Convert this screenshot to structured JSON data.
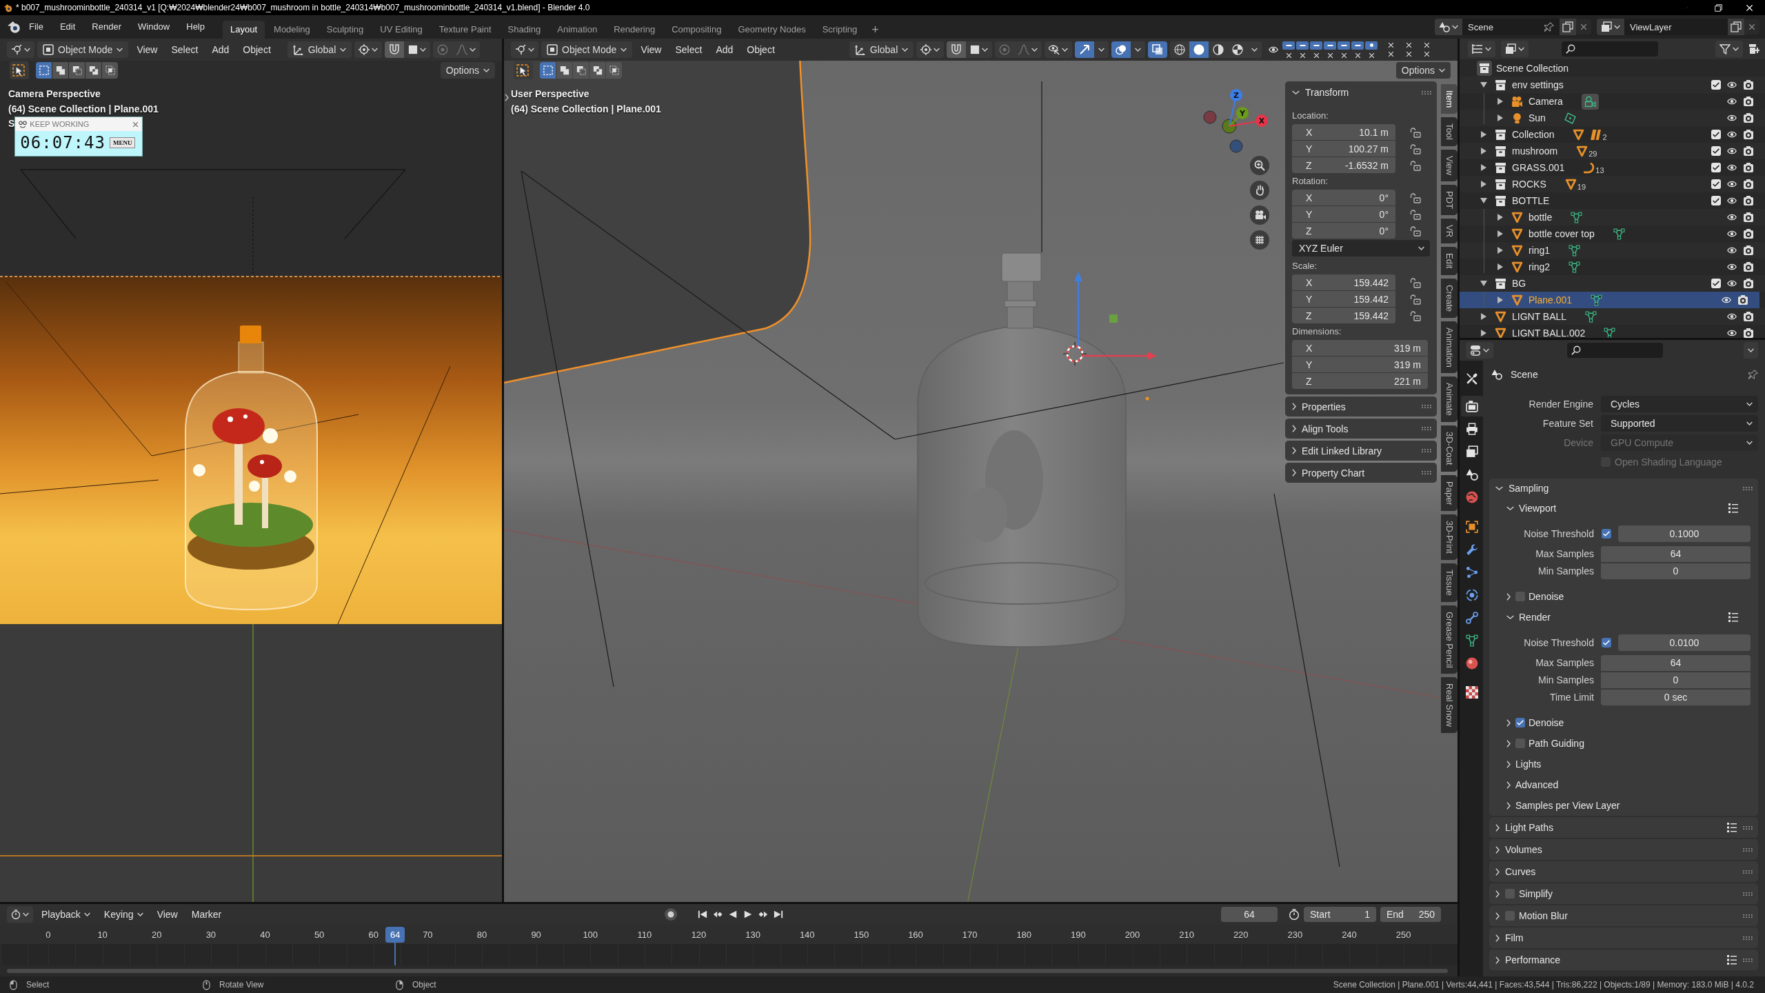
{
  "title_bar": {
    "title": "* b007_mushroominbottle_240314_v1 [Q:₩2024₩blender24₩b007_mushroom in bottle_240314₩b007_mushroominbottle_240314_v1.blend] - Blender 4.0"
  },
  "top_bar": {
    "menus": [
      "File",
      "Edit",
      "Render",
      "Window",
      "Help"
    ],
    "workspaces": [
      {
        "label": "Layout",
        "selected": true
      },
      {
        "label": "Modeling",
        "selected": false
      },
      {
        "label": "Sculpting",
        "selected": false
      },
      {
        "label": "UV Editing",
        "selected": false
      },
      {
        "label": "Texture Paint",
        "selected": false
      },
      {
        "label": "Shading",
        "selected": false
      },
      {
        "label": "Animation",
        "selected": false
      },
      {
        "label": "Rendering",
        "selected": false
      },
      {
        "label": "Compositing",
        "selected": false
      },
      {
        "label": "Geometry Nodes",
        "selected": false
      },
      {
        "label": "Scripting",
        "selected": false
      }
    ],
    "add_workspace": "+",
    "scene": "Scene",
    "view_layer": "ViewLayer"
  },
  "camera_view": {
    "header": {
      "mode": "Object Mode",
      "menus": [
        "View",
        "Select",
        "Add",
        "Object"
      ],
      "orientation": "Global",
      "snap": true,
      "proportional": false
    },
    "select_modes": [
      {
        "kind": "set",
        "selected": true
      },
      {
        "kind": "extend",
        "selected": false
      },
      {
        "kind": "subtract",
        "selected": false
      },
      {
        "kind": "difference",
        "selected": false
      },
      {
        "kind": "intersect",
        "selected": false
      }
    ],
    "options": "Options",
    "overlay": [
      "Camera Perspective",
      "(64) Scene Collection | Plane.001"
    ],
    "overlay_partial": "S",
    "timer": {
      "title": "KEEP WORKING",
      "time": "06:07:43",
      "menu": "MENU"
    }
  },
  "main_view": {
    "header": {
      "mode": "Object Mode",
      "menus": [
        "View",
        "Select",
        "Add",
        "Object"
      ],
      "orientation": "Global",
      "snap": true,
      "proportional": false,
      "gizmos": true,
      "overlays": true,
      "xray": true,
      "shading": [
        {
          "kind": "wireframe",
          "selected": false
        },
        {
          "kind": "solid",
          "selected": true
        },
        {
          "kind": "material",
          "selected": false
        },
        {
          "kind": "rendered",
          "selected": false
        }
      ],
      "toggles": [
        {
          "kind": "dash",
          "on": true
        },
        {
          "kind": "dash",
          "on": true
        },
        {
          "kind": "dash",
          "on": true
        },
        {
          "kind": "dash",
          "on": true
        },
        {
          "kind": "dash",
          "on": true
        },
        {
          "kind": "dash",
          "on": true
        },
        {
          "kind": "dot",
          "on": true
        }
      ]
    },
    "select_modes": [
      {
        "kind": "set",
        "selected": true
      },
      {
        "kind": "extend",
        "selected": false
      },
      {
        "kind": "subtract",
        "selected": false
      },
      {
        "kind": "difference",
        "selected": false
      },
      {
        "kind": "intersect",
        "selected": false
      }
    ],
    "options": "Options",
    "overlay": [
      "User Perspective",
      "(64) Scene Collection | Plane.001"
    ],
    "gizmo": {
      "x": "X",
      "y": "Y",
      "z": "Z"
    },
    "sidebar": {
      "tabs": [
        {
          "label": "Item",
          "selected": true
        },
        {
          "label": "Tool",
          "selected": false
        },
        {
          "label": "View",
          "selected": false
        },
        {
          "label": "PDT",
          "selected": false
        },
        {
          "label": "VR",
          "selected": false
        },
        {
          "label": "Edit",
          "selected": false
        },
        {
          "label": "Create",
          "selected": false
        },
        {
          "label": "Animation",
          "selected": false
        },
        {
          "label": "Animate",
          "selected": false
        },
        {
          "label": "3D-Coat",
          "selected": false
        },
        {
          "label": "Paper",
          "selected": false
        },
        {
          "label": "3D-Print",
          "selected": false
        },
        {
          "label": "Tissue",
          "selected": false
        },
        {
          "label": "Grease Pencil",
          "selected": false
        },
        {
          "label": "Real Snow",
          "selected": false
        }
      ],
      "transform": {
        "title": "Transform",
        "expanded": true,
        "groups": [
          {
            "kind": "lockable",
            "label": "Location:",
            "fields": [
              {
                "axis": "X",
                "value": "10.1 m",
                "locked": false
              },
              {
                "axis": "Y",
                "value": "100.27 m",
                "locked": false
              },
              {
                "axis": "Z",
                "value": "-1.6532 m",
                "locked": false
              }
            ]
          },
          {
            "kind": "lockable",
            "label": "Rotation:",
            "fields": [
              {
                "axis": "X",
                "value": "0°",
                "locked": false
              },
              {
                "axis": "Y",
                "value": "0°",
                "locked": false
              },
              {
                "axis": "Z",
                "value": "0°",
                "locked": false
              }
            ]
          },
          {
            "kind": "dropdown",
            "value": "XYZ Euler"
          },
          {
            "kind": "lockable",
            "label": "Scale:",
            "fields": [
              {
                "axis": "X",
                "value": "159.442",
                "locked": false
              },
              {
                "axis": "Y",
                "value": "159.442",
                "locked": false
              },
              {
                "axis": "Z",
                "value": "159.442",
                "locked": false
              }
            ]
          },
          {
            "kind": "plain",
            "label": "Dimensions:",
            "fields": [
              {
                "axis": "X",
                "value": "319 m"
              },
              {
                "axis": "Y",
                "value": "319 m"
              },
              {
                "axis": "Z",
                "value": "221 m"
              }
            ]
          }
        ]
      },
      "panels": [
        {
          "title": "Properties",
          "expanded": false
        },
        {
          "title": "Align Tools",
          "expanded": false
        },
        {
          "title": "Edit Linked Library",
          "expanded": false
        },
        {
          "title": "Property Chart",
          "expanded": false
        }
      ]
    }
  },
  "outliner": {
    "root": "Scene Collection",
    "items": [
      {
        "kind": "collection",
        "label": "env settings",
        "expanded": true,
        "selected": false,
        "checked": true,
        "children": [
          {
            "kind": "camera",
            "label": "Camera",
            "expanded": false,
            "selected": false,
            "data": [
              {
                "kind": "camera_data",
                "active": true
              }
            ]
          },
          {
            "kind": "light",
            "label": "Sun",
            "expanded": false,
            "selected": false,
            "data": [
              {
                "kind": "light_data",
                "active": false
              }
            ]
          }
        ]
      },
      {
        "kind": "collection",
        "label": "Collection",
        "expanded": false,
        "selected": false,
        "checked": true,
        "data": [
          {
            "kind": "mesh_object",
            "active": false
          },
          {
            "kind": "group_object",
            "active": false,
            "count": "2"
          }
        ]
      },
      {
        "kind": "collection",
        "label": "mushroom",
        "expanded": false,
        "selected": false,
        "checked": true,
        "data": [
          {
            "kind": "mesh_object",
            "active": false,
            "count": "29"
          }
        ]
      },
      {
        "kind": "collection",
        "label": "GRASS.001",
        "expanded": false,
        "selected": false,
        "checked": true,
        "data": [
          {
            "kind": "curve_object",
            "active": false,
            "count": "13"
          }
        ]
      },
      {
        "kind": "collection",
        "label": "ROCKS",
        "expanded": false,
        "selected": false,
        "checked": true,
        "data": [
          {
            "kind": "mesh_object",
            "active": false,
            "count": "19"
          }
        ]
      },
      {
        "kind": "collection",
        "label": "BOTTLE",
        "expanded": true,
        "selected": false,
        "checked": true,
        "children": [
          {
            "kind": "mesh",
            "label": "bottle",
            "expanded": false,
            "selected": false,
            "data": [
              {
                "kind": "mesh_data",
                "active": false
              }
            ]
          },
          {
            "kind": "mesh",
            "label": "bottle cover top",
            "expanded": false,
            "selected": false,
            "data": [
              {
                "kind": "mesh_data",
                "active": false
              }
            ]
          },
          {
            "kind": "mesh",
            "label": "ring1",
            "expanded": false,
            "selected": false,
            "data": [
              {
                "kind": "mesh_data",
                "active": false
              }
            ]
          },
          {
            "kind": "mesh",
            "label": "ring2",
            "expanded": false,
            "selected": false,
            "data": [
              {
                "kind": "mesh_data",
                "active": false
              }
            ]
          }
        ]
      },
      {
        "kind": "collection",
        "label": "BG",
        "expanded": true,
        "selected": false,
        "checked": true,
        "children": [
          {
            "kind": "mesh",
            "label": "Plane.001",
            "expanded": false,
            "selected": true,
            "data": [
              {
                "kind": "mesh_data",
                "active": false
              }
            ]
          }
        ]
      },
      {
        "kind": "mesh",
        "label": "LIGNT BALL",
        "expanded": false,
        "selected": false,
        "data": [
          {
            "kind": "mesh_data",
            "active": false
          }
        ]
      },
      {
        "kind": "mesh",
        "label": "LIGNT BALL.002",
        "expanded": false,
        "selected": false,
        "data": [
          {
            "kind": "mesh_data",
            "active": false
          }
        ]
      }
    ]
  },
  "properties": {
    "tabs": [
      {
        "kind": "tool",
        "selected": false
      },
      {
        "kind": "render",
        "selected": true
      },
      {
        "kind": "output",
        "selected": false
      },
      {
        "kind": "view_layer",
        "selected": false
      },
      {
        "kind": "scene",
        "selected": false
      },
      {
        "kind": "world",
        "selected": false
      },
      {
        "kind": "object",
        "selected": false
      },
      {
        "kind": "modifiers",
        "selected": false
      },
      {
        "kind": "particles",
        "selected": false
      },
      {
        "kind": "physics",
        "selected": false
      },
      {
        "kind": "constraints",
        "selected": false
      },
      {
        "kind": "data",
        "selected": false
      },
      {
        "kind": "material",
        "selected": false
      },
      {
        "kind": "texture",
        "selected": false
      }
    ],
    "context": "Scene",
    "fields": [
      {
        "kind": "dropdown",
        "label": "Render Engine",
        "value": "Cycles",
        "disabled": false
      },
      {
        "kind": "dropdown",
        "label": "Feature Set",
        "value": "Supported",
        "disabled": false
      },
      {
        "kind": "dropdown",
        "label": "Device",
        "value": "GPU Compute",
        "disabled": true
      },
      {
        "kind": "checkbox",
        "label": "Open Shading Language",
        "checked": false,
        "disabled": true
      }
    ],
    "panels": [
      {
        "title": "Sampling",
        "expanded": true,
        "presets": false,
        "subpanels": [
          {
            "title": "Viewport",
            "expanded": true,
            "presets": true,
            "rows": [
              {
                "kind": "toggle_number",
                "label": "Noise Threshold",
                "checked": true,
                "value": "0.1000"
              },
              {
                "kind": "number",
                "label": "Max Samples",
                "value": "64"
              },
              {
                "kind": "number",
                "label": "Min Samples",
                "value": "0"
              }
            ]
          },
          {
            "title": "Denoise",
            "expanded": false,
            "presets": false,
            "checked": false
          },
          {
            "title": "Render",
            "expanded": true,
            "presets": true,
            "rows": [
              {
                "kind": "toggle_number",
                "label": "Noise Threshold",
                "checked": true,
                "value": "0.0100"
              },
              {
                "kind": "number",
                "label": "Max Samples",
                "value": "64"
              },
              {
                "kind": "number",
                "label": "Min Samples",
                "value": "0"
              },
              {
                "kind": "number",
                "label": "Time Limit",
                "value": "0 sec"
              }
            ]
          },
          {
            "title": "Denoise",
            "expanded": false,
            "presets": false,
            "checked": true
          },
          {
            "title": "Path Guiding",
            "expanded": false,
            "presets": false,
            "checked": false
          },
          {
            "title": "Lights",
            "expanded": false,
            "presets": false
          },
          {
            "title": "Advanced",
            "expanded": false,
            "presets": false
          },
          {
            "title": "Samples per View Layer",
            "expanded": false,
            "presets": false
          }
        ]
      },
      {
        "title": "Light Paths",
        "expanded": false,
        "presets": true
      },
      {
        "title": "Volumes",
        "expanded": false,
        "presets": false
      },
      {
        "title": "Curves",
        "expanded": false,
        "presets": false
      },
      {
        "title": "Simplify",
        "expanded": false,
        "presets": false,
        "checked": false
      },
      {
        "title": "Motion Blur",
        "expanded": false,
        "presets": false,
        "checked": false
      },
      {
        "title": "Film",
        "expanded": false,
        "presets": false
      },
      {
        "title": "Performance",
        "expanded": false,
        "presets": true
      }
    ]
  },
  "timeline": {
    "menus": [
      {
        "label": "Playback",
        "kind": "dropdown"
      },
      {
        "label": "Keying",
        "kind": "dropdown"
      },
      {
        "label": "View",
        "kind": "menu"
      },
      {
        "label": "Marker",
        "kind": "menu"
      }
    ],
    "auto_keying": false,
    "current_frame": "64",
    "start_label": "Start",
    "start": "1",
    "end_label": "End",
    "end": "250",
    "ticks": [
      "0",
      "10",
      "20",
      "30",
      "40",
      "50",
      "60",
      "70",
      "80",
      "90",
      "100",
      "110",
      "120",
      "130",
      "140",
      "150",
      "160",
      "170",
      "180",
      "190",
      "200",
      "210",
      "220",
      "230",
      "240",
      "250"
    ],
    "playhead": "64"
  },
  "status_bar": {
    "hints": [
      {
        "kind": "left_click",
        "label": "Select"
      },
      {
        "kind": "middle_click",
        "label": "Rotate View"
      },
      {
        "kind": "right_click",
        "label": "Object"
      }
    ],
    "stats": "Scene Collection | Plane.001 | Verts:44,441 | Faces:43,544 | Tris:86,222 | Objects:1/89 | Memory: 183.0 MiB | 4.0.2"
  }
}
